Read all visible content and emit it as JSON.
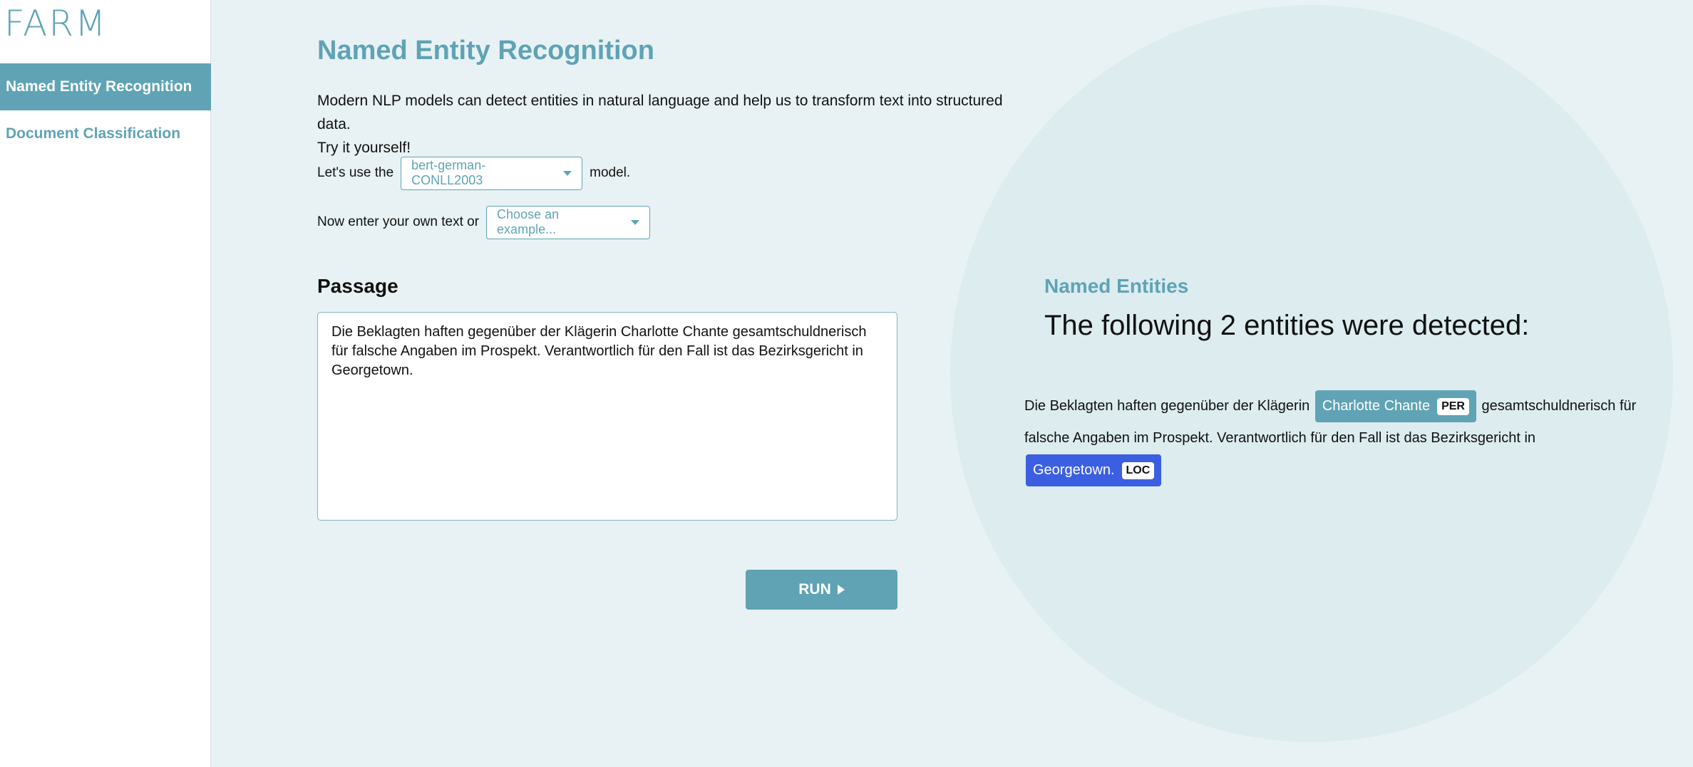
{
  "sidebar": {
    "logo": "FARM",
    "items": [
      {
        "label": "Named Entity Recognition",
        "active": true
      },
      {
        "label": "Document Classification",
        "active": false
      }
    ]
  },
  "main": {
    "title": "Named Entity Recognition",
    "intro_line1": "Modern NLP models can detect entities in natural language and help us to transform text into structured data.",
    "intro_line2": "Try it yourself!",
    "model_prefix": "Let's use the",
    "model_select_value": "bert-german-CONLL2003",
    "model_suffix": "model.",
    "example_prefix": "Now enter your own text or",
    "example_select_placeholder": "Choose an example...",
    "passage_label": "Passage",
    "passage_text": "Die Beklagten haften gegenüber der Klägerin Charlotte Chante gesamtschuldnerisch für falsche Angaben im Prospekt. Verantwortlich für den Fall ist das Bezirksgericht in Georgetown.",
    "run_label": "RUN"
  },
  "results": {
    "label": "Named Entities",
    "heading": "The following 2 entities were detected:",
    "text_before_per": "Die Beklagten haften gegenüber der Klägerin",
    "entity_per": {
      "text": "Charlotte Chante",
      "tag": "PER",
      "color": "#5fa3b5"
    },
    "text_between": "gesamtschuldnerisch für falsche Angaben im Prospekt. Verantwortlich für den Fall ist das Bezirksgericht in",
    "entity_loc": {
      "text": "Georgetown.",
      "tag": "LOC",
      "color": "#3b5fe0"
    }
  },
  "colors": {
    "accent": "#5fa3b5",
    "background": "#e8f2f4",
    "circle": "#dcecef",
    "loc_entity": "#3b5fe0"
  }
}
